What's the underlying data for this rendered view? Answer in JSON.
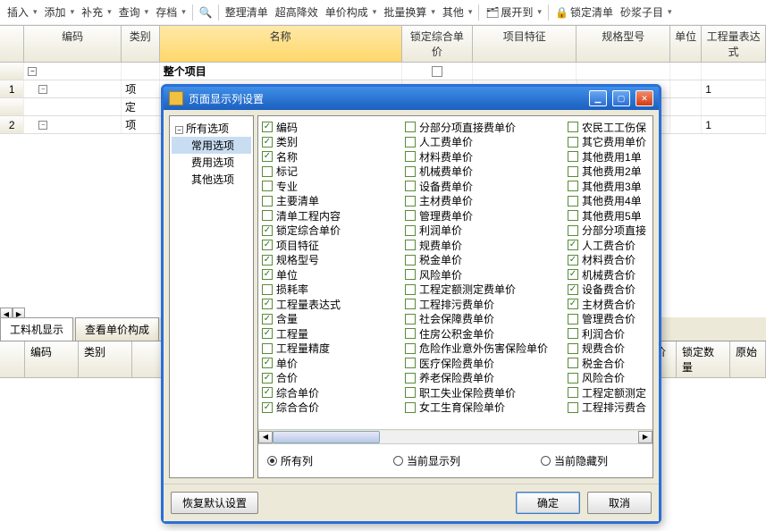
{
  "toolbar": {
    "items": [
      {
        "label": "插入",
        "dd": true
      },
      {
        "label": "添加",
        "dd": true
      },
      {
        "label": "补充",
        "dd": true
      },
      {
        "label": "查询",
        "dd": true
      },
      {
        "label": "存档",
        "dd": true,
        "sep_after": true
      },
      {
        "label": "",
        "icon": "binoculars",
        "sep_after": true
      },
      {
        "label": "整理清单"
      },
      {
        "label": "超高降效"
      },
      {
        "label": "单价构成",
        "dd": true
      },
      {
        "label": "批量换算",
        "dd": true
      },
      {
        "label": "其他",
        "dd": true,
        "sep_after": true
      },
      {
        "label": "展开到",
        "icon": "org",
        "dd": true,
        "sep_after": true
      },
      {
        "label": "锁定清单",
        "icon": "lock"
      },
      {
        "label": "砂浆子目",
        "dd": true
      }
    ]
  },
  "grid": {
    "headers": [
      "编码",
      "类别",
      "名称",
      "锁定综合单价",
      "项目特征",
      "规格型号",
      "单位",
      "工程量表达式"
    ],
    "rows": [
      {
        "num": "",
        "code": "",
        "type": "",
        "name": "整个项目",
        "lock_chk": true,
        "unit": "",
        "expr": ""
      },
      {
        "num": "1",
        "code": "",
        "type": "项",
        "name": "",
        "lock_chk": true,
        "unit": "",
        "expr": "1"
      },
      {
        "num": "",
        "code": "",
        "type": "定",
        "name": "",
        "lock_chk": false,
        "unit": "",
        "expr": ""
      },
      {
        "num": "2",
        "code": "",
        "type": "项",
        "name": "",
        "lock_chk": false,
        "unit": "",
        "expr": "1"
      }
    ]
  },
  "sec": {
    "tabs": [
      "工料机显示",
      "查看单价构成"
    ],
    "headers": [
      "编码",
      "类别"
    ],
    "right_headers": [
      "价",
      "锁定数量",
      "原始"
    ]
  },
  "dialog": {
    "title": "页面显示列设置",
    "tree": {
      "root": "所有选项",
      "children": [
        "常用选项",
        "费用选项",
        "其他选项"
      ]
    },
    "cols": [
      [
        {
          "l": "编码",
          "c": true
        },
        {
          "l": "类别",
          "c": true
        },
        {
          "l": "名称",
          "c": true
        },
        {
          "l": "标记",
          "c": false
        },
        {
          "l": "专业",
          "c": false
        },
        {
          "l": "主要清单",
          "c": false
        },
        {
          "l": "清单工程内容",
          "c": false
        },
        {
          "l": "锁定综合单价",
          "c": true
        },
        {
          "l": "项目特征",
          "c": true
        },
        {
          "l": "规格型号",
          "c": true
        },
        {
          "l": "单位",
          "c": true
        },
        {
          "l": "损耗率",
          "c": false
        },
        {
          "l": "工程量表达式",
          "c": true
        },
        {
          "l": "含量",
          "c": true
        },
        {
          "l": "工程量",
          "c": true
        },
        {
          "l": "工程量精度",
          "c": false
        },
        {
          "l": "单价",
          "c": true
        },
        {
          "l": "合价",
          "c": true
        },
        {
          "l": "综合单价",
          "c": true
        },
        {
          "l": "综合合价",
          "c": true
        }
      ],
      [
        {
          "l": "分部分项直接费单价",
          "c": false
        },
        {
          "l": "人工费单价",
          "c": false
        },
        {
          "l": "材料费单价",
          "c": false
        },
        {
          "l": "机械费单价",
          "c": false
        },
        {
          "l": "设备费单价",
          "c": false
        },
        {
          "l": "主材费单价",
          "c": false
        },
        {
          "l": "管理费单价",
          "c": false
        },
        {
          "l": "利润单价",
          "c": false
        },
        {
          "l": "规费单价",
          "c": false
        },
        {
          "l": "税金单价",
          "c": false
        },
        {
          "l": "风险单价",
          "c": false
        },
        {
          "l": "工程定额测定费单价",
          "c": false
        },
        {
          "l": "工程排污费单价",
          "c": false
        },
        {
          "l": "社会保障费单价",
          "c": false
        },
        {
          "l": "住房公积金单价",
          "c": false
        },
        {
          "l": "危险作业意外伤害保险单价",
          "c": false
        },
        {
          "l": "医疗保险费单价",
          "c": false
        },
        {
          "l": "养老保险费单价",
          "c": false
        },
        {
          "l": "职工失业保险费单价",
          "c": false
        },
        {
          "l": "女工生育保险单价",
          "c": false
        }
      ],
      [
        {
          "l": "农民工工伤保",
          "c": false
        },
        {
          "l": "其它费用单价",
          "c": false
        },
        {
          "l": "其他费用1单",
          "c": false
        },
        {
          "l": "其他费用2单",
          "c": false
        },
        {
          "l": "其他费用3单",
          "c": false
        },
        {
          "l": "其他费用4单",
          "c": false
        },
        {
          "l": "其他费用5单",
          "c": false
        },
        {
          "l": "分部分项直接",
          "c": false
        },
        {
          "l": "人工费合价",
          "c": true
        },
        {
          "l": "材料费合价",
          "c": true
        },
        {
          "l": "机械费合价",
          "c": true
        },
        {
          "l": "设备费合价",
          "c": true
        },
        {
          "l": "主材费合价",
          "c": true
        },
        {
          "l": "管理费合价",
          "c": false
        },
        {
          "l": "利润合价",
          "c": false
        },
        {
          "l": "规费合价",
          "c": false
        },
        {
          "l": "税金合价",
          "c": false
        },
        {
          "l": "风险合价",
          "c": false
        },
        {
          "l": "工程定额测定",
          "c": false
        },
        {
          "l": "工程排污费合",
          "c": false
        }
      ]
    ],
    "radios": [
      "所有列",
      "当前显示列",
      "当前隐藏列"
    ],
    "radio_sel": 0,
    "btn_reset": "恢复默认设置",
    "btn_ok": "确定",
    "btn_cancel": "取消"
  }
}
